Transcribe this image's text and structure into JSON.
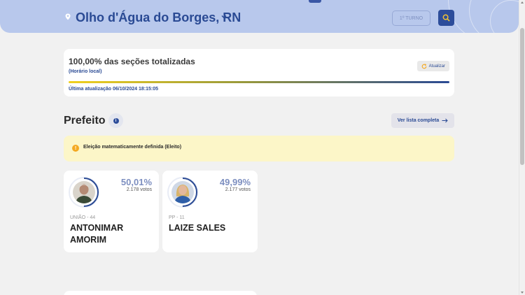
{
  "header": {
    "city": "Olho d'Água do Borges, RN",
    "turno_label": "1º TURNO",
    "icons": [
      "location-pin-icon",
      "chevron-down-icon",
      "search-icon"
    ]
  },
  "status": {
    "title": "100,00% das seções totalizadas",
    "subtitle": "(Horário local)",
    "refresh_label": "Atualizar",
    "progress_percent": 100,
    "last_update": "Última atualização 06/10/2024 18:15:05"
  },
  "section": {
    "title": "Prefeito",
    "list_button": "Ver lista completa"
  },
  "banner": {
    "message": "Eleição matematicamente definida (Eleito)"
  },
  "candidates": [
    {
      "percent": "50,01%",
      "votes": "2.178 votos",
      "party": "UNIÃO - 44",
      "name": "ANTONIMAR AMORIM",
      "share": 0.5001
    },
    {
      "percent": "49,99%",
      "votes": "2.177 votos",
      "party": "PP - 11",
      "name": "LAIZE SALES",
      "share": 0.4999
    }
  ],
  "colors": {
    "primary": "#2a4a94",
    "header_bg": "#b8c8ec",
    "banner_bg": "#fcf6c8",
    "warning": "#f4a922",
    "percent": "#7d8fc0"
  }
}
